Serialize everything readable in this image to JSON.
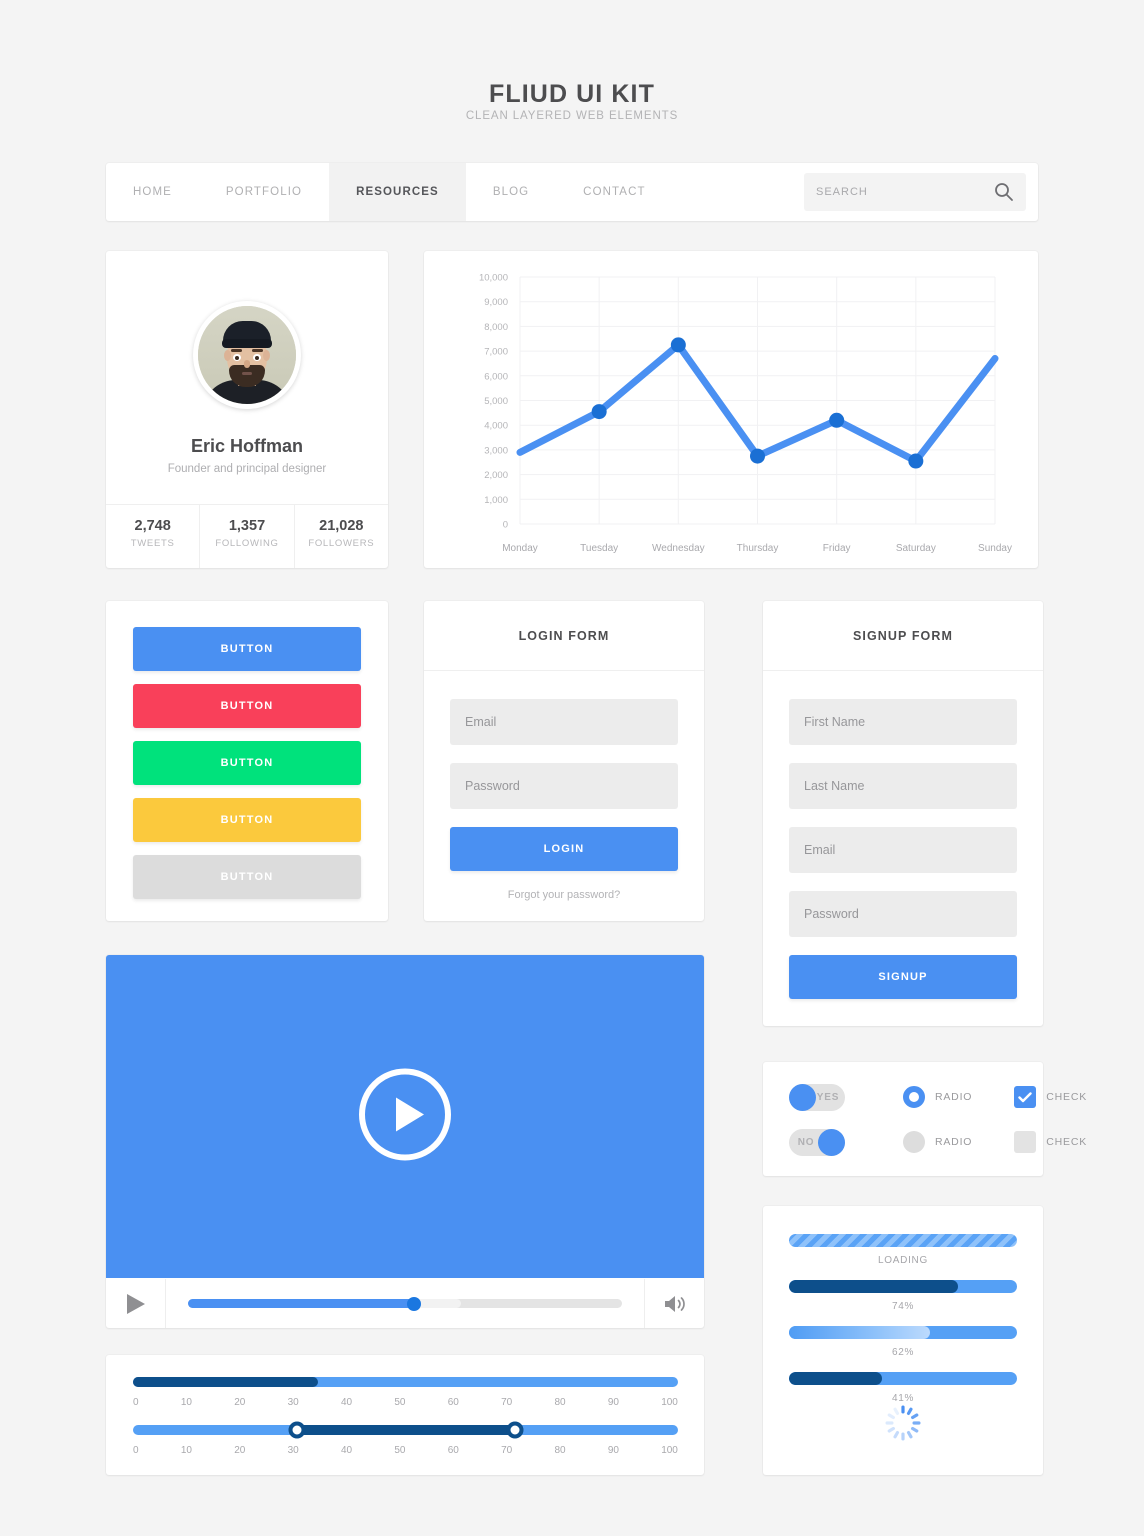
{
  "header": {
    "title": "FLIUD UI KIT",
    "subtitle": "CLEAN LAYERED WEB ELEMENTS"
  },
  "nav": {
    "items": [
      {
        "label": "HOME",
        "active": false
      },
      {
        "label": "PORTFOLIO",
        "active": false
      },
      {
        "label": "RESOURCES",
        "active": true
      },
      {
        "label": "BLOG",
        "active": false
      },
      {
        "label": "CONTACT",
        "active": false
      }
    ],
    "search": {
      "value": "",
      "placeholder": "SEARCH",
      "icon": "search-icon"
    }
  },
  "profile": {
    "avatar_alt": "user-avatar-photo",
    "name": "Eric Hoffman",
    "role": "Founder and principal designer",
    "stats": [
      {
        "value": "2,748",
        "label": "TWEETS"
      },
      {
        "value": "1,357",
        "label": "FOLLOWING"
      },
      {
        "value": "21,028",
        "label": "FOLLOWERS"
      }
    ]
  },
  "chart_data": {
    "type": "line",
    "title": "",
    "xlabel": "",
    "ylabel": "",
    "categories": [
      "Monday",
      "Tuesday",
      "Wednesday",
      "Thursday",
      "Friday",
      "Saturday",
      "Sunday"
    ],
    "values": [
      2900,
      4550,
      7250,
      2750,
      4200,
      2550,
      6700
    ],
    "ytick_labels": [
      "10,000",
      "9,000",
      "8,000",
      "7,000",
      "6,000",
      "5,000",
      "4,000",
      "3,000",
      "2,000",
      "1,000",
      "0"
    ],
    "ylim": [
      0,
      10000
    ],
    "ytick_step": 1000,
    "grid": true,
    "legend": "none",
    "line_color": "#4a90f2",
    "marker_color": "#1a6fd4",
    "markers_shown_at": [
      "Tuesday",
      "Wednesday",
      "Thursday",
      "Friday",
      "Saturday"
    ]
  },
  "buttons_panel": {
    "buttons": [
      {
        "label": "BUTTON",
        "color": "#4a90f2"
      },
      {
        "label": "BUTTON",
        "color": "#f9405a"
      },
      {
        "label": "BUTTON",
        "color": "#00e27c"
      },
      {
        "label": "BUTTON",
        "color": "#fbc93d"
      },
      {
        "label": "BUTTON",
        "color": "#dcdcdc",
        "text_color": "#ffffff"
      }
    ]
  },
  "login_form": {
    "title": "LOGIN FORM",
    "email": {
      "value": "",
      "placeholder": "Email"
    },
    "password": {
      "value": "",
      "placeholder": "Password"
    },
    "submit_label": "LOGIN",
    "forgot_label": "Forgot your password?"
  },
  "signup_form": {
    "title": "SIGNUP FORM",
    "first_name": {
      "value": "",
      "placeholder": "First Name"
    },
    "last_name": {
      "value": "",
      "placeholder": "Last Name"
    },
    "email": {
      "value": "",
      "placeholder": "Email"
    },
    "password": {
      "value": "",
      "placeholder": "Password"
    },
    "submit_label": "SIGNUP"
  },
  "video": {
    "play_overlay_icon": "play-circle-icon",
    "play_button_icon": "play-icon",
    "volume_icon": "volume-icon",
    "progress_percent": 52,
    "buffered_percent": 63,
    "screen_color": "#4a90f2"
  },
  "sliders": {
    "single": {
      "value": 34,
      "ticks": [
        "0",
        "10",
        "20",
        "30",
        "40",
        "50",
        "60",
        "70",
        "80",
        "90",
        "100"
      ]
    },
    "range": {
      "low": 30,
      "high": 70,
      "ticks": [
        "0",
        "10",
        "20",
        "30",
        "40",
        "50",
        "60",
        "70",
        "80",
        "90",
        "100"
      ]
    }
  },
  "controls": {
    "toggle_on": {
      "label": "YES",
      "state": "on"
    },
    "toggle_off": {
      "label": "NO",
      "state": "off"
    },
    "radio_on": {
      "label": "RADIO",
      "checked": true
    },
    "radio_off": {
      "label": "RADIO",
      "checked": false
    },
    "check_on": {
      "label": "CHECK",
      "checked": true
    },
    "check_off": {
      "label": "CHECK",
      "checked": false
    }
  },
  "progress": {
    "loading": {
      "label": "LOADING",
      "striped": true
    },
    "bar1": {
      "label": "74%",
      "percent": 74
    },
    "bar2": {
      "label": "62%",
      "percent": 62
    },
    "bar3": {
      "label": "41%",
      "percent": 41
    },
    "spinner_icon": "loading-spinner-icon"
  },
  "colors": {
    "accent_blue": "#4a90f2",
    "dark_blue": "#0d4f8b",
    "light_blue": "#55a0f5",
    "red": "#f9405a",
    "green": "#00e27c",
    "yellow": "#fbc93d",
    "grey": "#dcdcdc",
    "page_bg": "#f4f4f4"
  }
}
